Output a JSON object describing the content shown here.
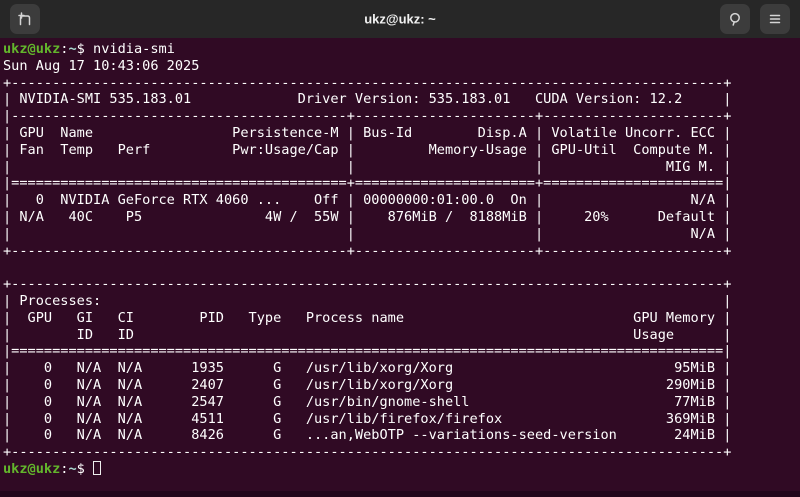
{
  "window": {
    "title": "ukz@ukz: ~"
  },
  "header": {
    "new_tab_icon": "new-tab-icon",
    "search_icon": "search-icon",
    "menu_icon": "menu-icon"
  },
  "colors": {
    "terminal_background": "#300a24",
    "titlebar_background": "#272727",
    "button_background": "#3c3c3c",
    "text": "#ffffff",
    "prompt_user_green": "#63b62c",
    "prompt_path_teal": "#a9d8d0"
  },
  "terminal": {
    "prompt": {
      "user_host": "ukz@ukz",
      "colon": ":",
      "path": "~",
      "dollar": "$"
    },
    "command": "nvidia-smi",
    "output": [
      "Sun Aug 17 10:43:06 2025",
      "+---------------------------------------------------------------------------------------+",
      "| NVIDIA-SMI 535.183.01             Driver Version: 535.183.01   CUDA Version: 12.2     |",
      "|-----------------------------------------+----------------------+----------------------+",
      "| GPU  Name                 Persistence-M | Bus-Id        Disp.A | Volatile Uncorr. ECC |",
      "| Fan  Temp   Perf          Pwr:Usage/Cap |         Memory-Usage | GPU-Util  Compute M. |",
      "|                                         |                      |               MIG M. |",
      "|=========================================+======================+======================|",
      "|   0  NVIDIA GeForce RTX 4060 ...    Off | 00000000:01:00.0  On |                  N/A |",
      "| N/A   40C    P5               4W /  55W |    876MiB /  8188MiB |     20%      Default |",
      "|                                         |                      |                  N/A |",
      "+-----------------------------------------+----------------------+----------------------+",
      "",
      "+---------------------------------------------------------------------------------------+",
      "| Processes:                                                                            |",
      "|  GPU   GI   CI        PID   Type   Process name                            GPU Memory |",
      "|        ID   ID                                                             Usage      |",
      "|=======================================================================================|",
      "|    0   N/A  N/A      1935      G   /usr/lib/xorg/Xorg                           95MiB |",
      "|    0   N/A  N/A      2407      G   /usr/lib/xorg/Xorg                          290MiB |",
      "|    0   N/A  N/A      2547      G   /usr/bin/gnome-shell                         77MiB |",
      "|    0   N/A  N/A      4511      G   /usr/lib/firefox/firefox                    369MiB |",
      "|    0   N/A  N/A      8426      G   ...an,WebOTP --variations-seed-version       24MiB |",
      "+---------------------------------------------------------------------------------------+"
    ]
  }
}
